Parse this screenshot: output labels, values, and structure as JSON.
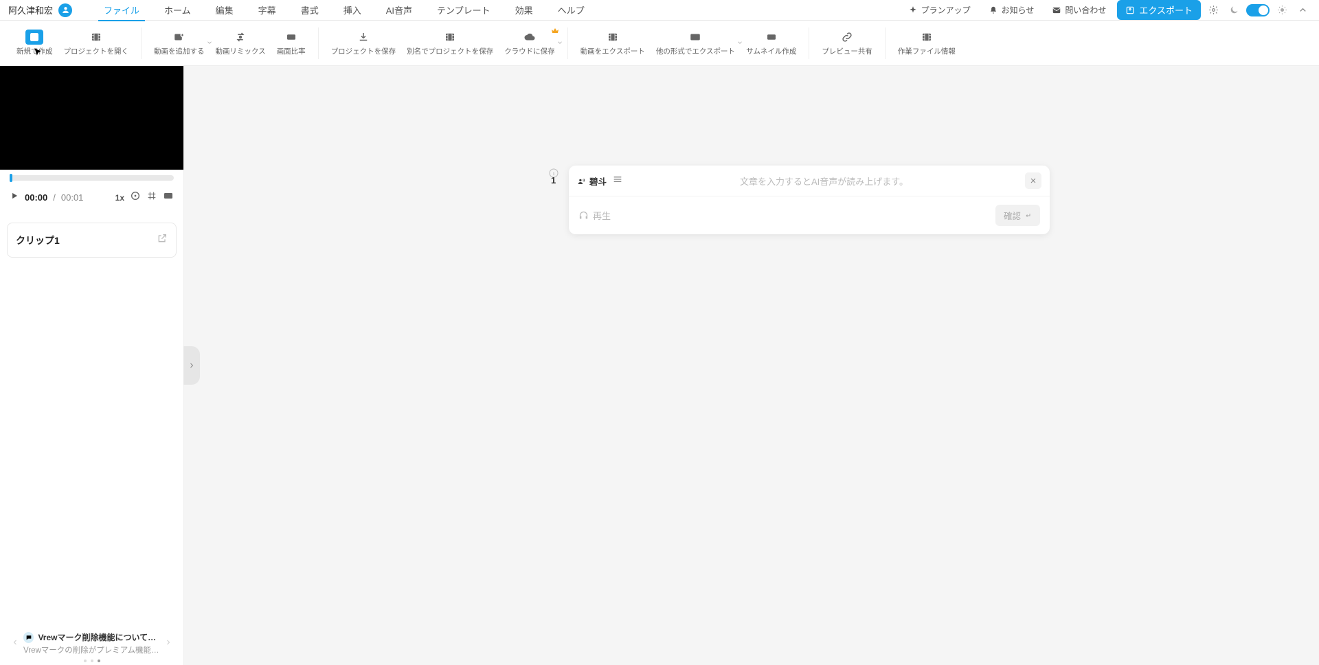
{
  "user": {
    "name": "阿久津和宏"
  },
  "menu": {
    "tabs": [
      "ファイル",
      "ホーム",
      "編集",
      "字幕",
      "書式",
      "挿入",
      "AI音声",
      "テンプレート",
      "効果",
      "ヘルプ"
    ],
    "active_index": 0
  },
  "header_right": {
    "plan": "プランアップ",
    "notice": "お知らせ",
    "contact": "問い合わせ",
    "export": "エクスポート"
  },
  "toolbar": {
    "items": [
      {
        "label": "新規で作成",
        "icon": "add-file",
        "active": true
      },
      {
        "label": "プロジェクトを開く",
        "icon": "film"
      },
      {
        "label": "動画を追加する",
        "icon": "add-video",
        "chevron": true
      },
      {
        "label": "動画リミックス",
        "icon": "remix"
      },
      {
        "label": "画面比率",
        "icon": "ratio"
      },
      {
        "label": "プロジェクトを保存",
        "icon": "save"
      },
      {
        "label": "別名でプロジェクトを保存",
        "icon": "save-as"
      },
      {
        "label": "クラウドに保存",
        "icon": "cloud",
        "crown": true,
        "chevron": true
      },
      {
        "label": "動画をエクスポート",
        "icon": "export-video"
      },
      {
        "label": "他の形式でエクスポート",
        "icon": "export-other",
        "chevron": true
      },
      {
        "label": "サムネイル作成",
        "icon": "thumb"
      },
      {
        "label": "プレビュー共有",
        "icon": "link"
      },
      {
        "label": "作業ファイル情報",
        "icon": "info-film"
      }
    ],
    "separators_after": [
      1,
      4,
      7,
      10,
      11
    ]
  },
  "player": {
    "current": "00:00",
    "duration": "00:01",
    "speed": "1x"
  },
  "clip": {
    "title": "クリップ1"
  },
  "card": {
    "index": "1",
    "voice": "碧斗",
    "placeholder": "文章を入力するとAI音声が読み上げます。",
    "listen": "再生",
    "confirm": "確認"
  },
  "news": {
    "title": "Vrewマーク削除機能についてご…",
    "sub": "Vrewマークの削除がプレミアム機能…"
  }
}
